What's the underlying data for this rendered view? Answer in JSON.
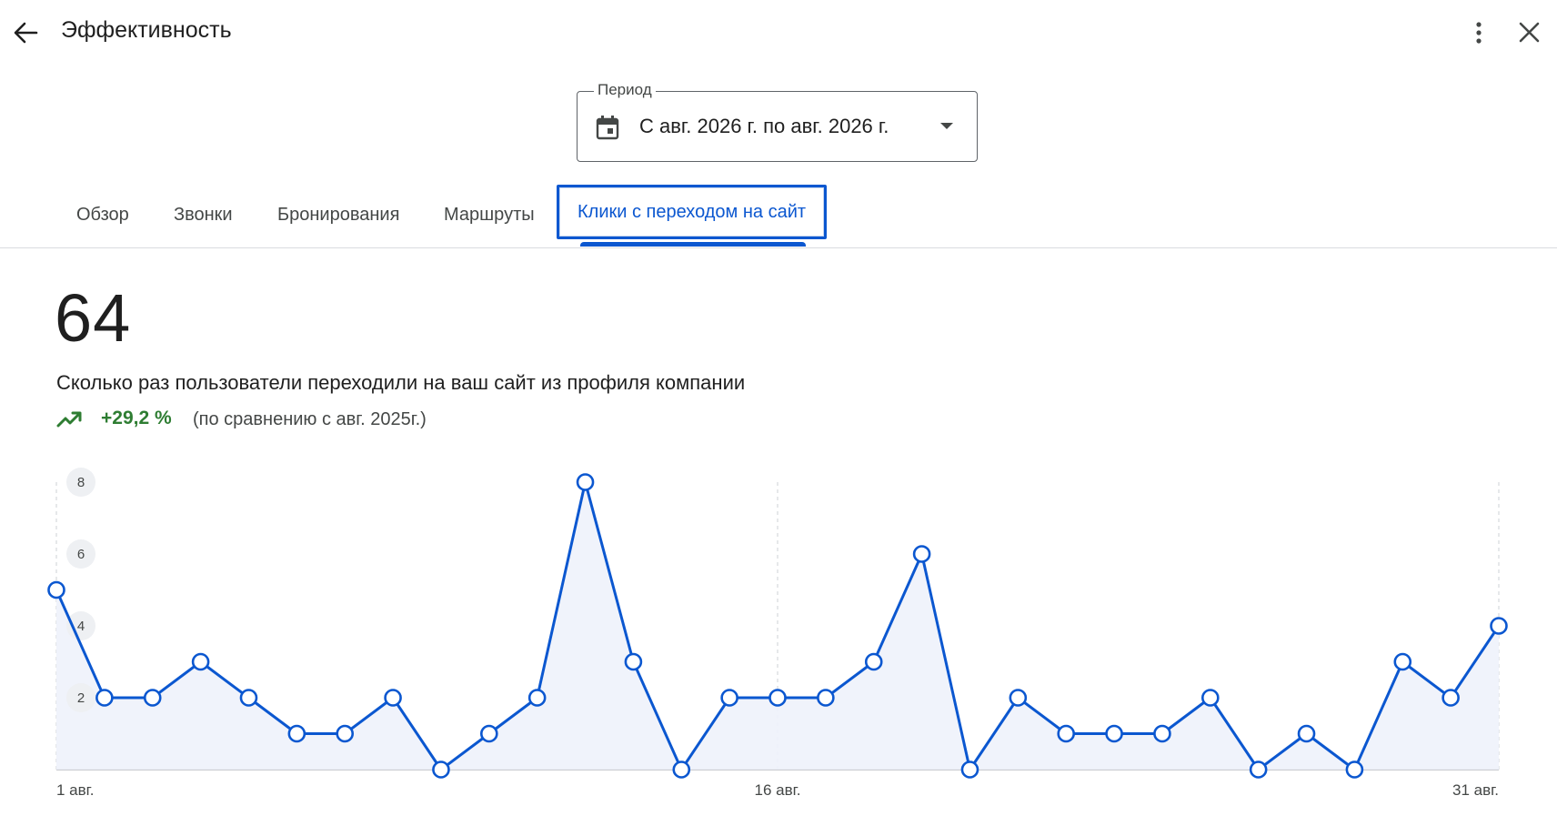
{
  "header": {
    "title": "Эффективность",
    "back_icon": "arrow-back-icon",
    "more_icon": "more-vert-icon",
    "close_icon": "close-icon"
  },
  "period": {
    "label": "Период",
    "value": "С авг. 2026 г. по авг. 2026 г.",
    "calendar_icon": "calendar-icon",
    "dropdown_icon": "arrow-drop-down-icon"
  },
  "tabs": [
    {
      "label": "Обзор",
      "active": false
    },
    {
      "label": "Звонки",
      "active": false
    },
    {
      "label": "Бронирования",
      "active": false
    },
    {
      "label": "Маршруты",
      "active": false
    },
    {
      "label": "Клики с переходом на сайт",
      "active": true
    }
  ],
  "summary": {
    "total": "64",
    "description": "Сколько раз пользователи переходили на ваш сайт из профиля компании",
    "change": "+29,2 %",
    "compare_text": "(по сравнению с авг. 2025г.)",
    "trend_icon": "trending-up-icon"
  },
  "colors": {
    "accent": "#0b57d0",
    "positive": "#2e7d32",
    "area_fill": "#eef2fb"
  },
  "chart_data": {
    "type": "line",
    "x": [
      1,
      2,
      3,
      4,
      5,
      6,
      7,
      8,
      9,
      10,
      11,
      12,
      13,
      14,
      15,
      16,
      17,
      18,
      19,
      20,
      21,
      22,
      23,
      24,
      25,
      26,
      27,
      28,
      29,
      30,
      31
    ],
    "values": [
      5,
      2,
      2,
      3,
      2,
      1,
      1,
      2,
      0,
      1,
      2,
      8,
      3,
      0,
      2,
      2,
      2,
      3,
      6,
      0,
      2,
      1,
      1,
      1,
      2,
      0,
      1,
      0,
      3,
      2,
      4
    ],
    "x_tick_labels": [
      "1 авг.",
      "16 авг.",
      "31 авг."
    ],
    "x_tick_positions": [
      1,
      16,
      31
    ],
    "y_ticks": [
      2,
      4,
      6,
      8
    ],
    "ylim": [
      0,
      8
    ],
    "area": true,
    "markers": "hollow-circle",
    "grid": "vertical-dashed"
  }
}
